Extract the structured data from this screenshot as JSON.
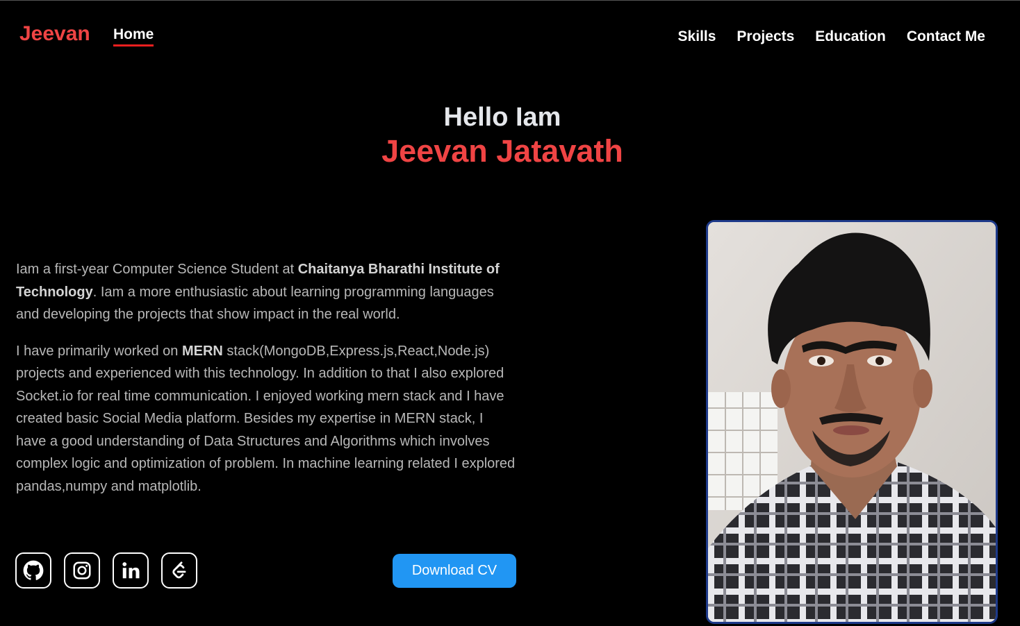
{
  "nav": {
    "brand": "Jeevan",
    "home": "Home",
    "links": [
      "Skills",
      "Projects",
      "Education",
      "Contact Me"
    ]
  },
  "hero": {
    "greeting": "Hello Iam",
    "name": "Jeevan Jatavath"
  },
  "about": {
    "p1_a": "Iam a first-year Computer Science Student at ",
    "p1_b": "Chaitanya Bharathi Institute of Technology",
    "p1_c": ". Iam a more enthusiastic about learning programming languages and developing the projects that show impact in the real world.",
    "p2_a": "I have primarily worked on ",
    "p2_b": "MERN",
    "p2_c": " stack(MongoDB,Express.js,React,Node.js) projects and experienced with this technology. In addition to that I also explored Socket.io for real time communication. I enjoyed working mern stack and I have created basic Social Media platform. Besides my expertise in MERN stack, I have a good understanding of Data Structures and Algorithms which involves complex logic and optimization of problem. In machine learning related I explored pandas,numpy and matplotlib."
  },
  "socials": [
    {
      "icon": "github-icon"
    },
    {
      "icon": "instagram-icon"
    },
    {
      "icon": "linkedin-icon"
    },
    {
      "icon": "leetcode-icon"
    }
  ],
  "cv_button": "Download CV",
  "colors": {
    "accent": "#ef4444",
    "button": "#2196f3",
    "frame": "#1e3a8a"
  }
}
